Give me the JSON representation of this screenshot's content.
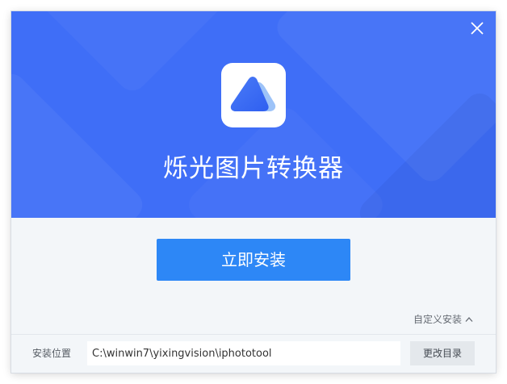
{
  "app": {
    "title": "烁光图片转换器"
  },
  "actions": {
    "install_label": "立即安装",
    "custom_install_label": "自定义安装",
    "change_dir_label": "更改目录"
  },
  "install_path": {
    "label": "安装位置",
    "value": "C:\\winwin7\\yixingvision\\iphototool"
  },
  "icons": {
    "close": "close-icon",
    "logo": "mountain-logo-icon",
    "expand": "chevron-up-icon"
  },
  "colors": {
    "hero_background": "#3f6ef7",
    "install_button": "#2d87f6",
    "footer_background": "#f3f6f9"
  }
}
